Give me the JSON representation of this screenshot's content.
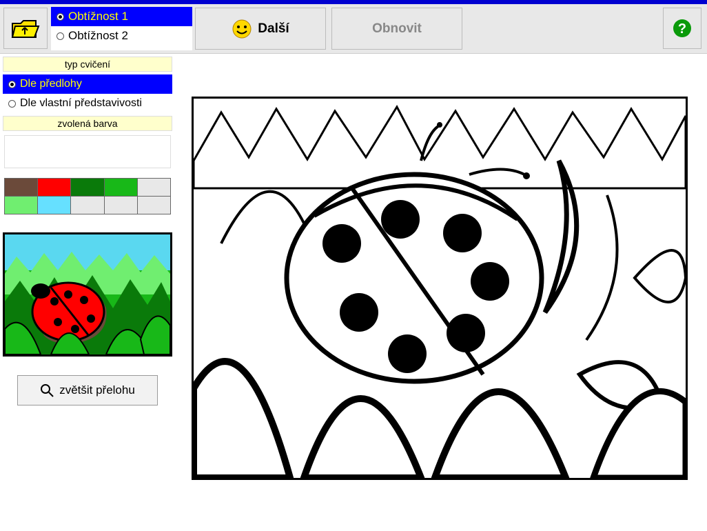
{
  "toolbar": {
    "difficulty": [
      {
        "label": "Obtížnost 1",
        "selected": true
      },
      {
        "label": "Obtížnost 2",
        "selected": false
      }
    ],
    "next_label": "Další",
    "refresh_label": "Obnovit"
  },
  "sidebar": {
    "exercise_type_header": "typ cvičení",
    "exercise_options": [
      {
        "label": "Dle předlohy",
        "selected": true
      },
      {
        "label": "Dle vlastní představivosti",
        "selected": false
      }
    ],
    "selected_color_header": "zvolená barva",
    "palette": [
      "#6b4a3a",
      "#ff0000",
      "#0a7a0a",
      "#18b818",
      "#70ee70",
      "#66e0ff"
    ],
    "zoom_label": "zvětšit přelohu"
  }
}
